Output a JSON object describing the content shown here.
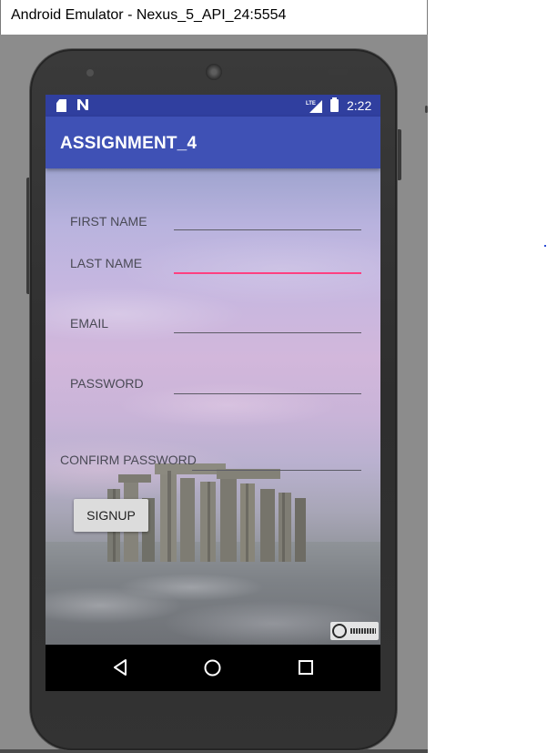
{
  "window": {
    "title": "Android Emulator - Nexus_5_API_24:5554"
  },
  "statusbar": {
    "time": "2:22",
    "network_label": "LTE",
    "icons": [
      "sd-card-icon",
      "n-notification-icon",
      "lte-signal-icon",
      "battery-icon"
    ]
  },
  "appbar": {
    "title": "ASSIGNMENT_4"
  },
  "form": {
    "first_name_label": "FIRST NAME",
    "first_name_value": "",
    "last_name_label": "LAST NAME",
    "last_name_value": "",
    "email_label": "EMAIL",
    "email_value": "",
    "password_label": "PASSWORD",
    "password_value": "",
    "confirm_password_label": "CONFIRM PASSWORD",
    "confirm_password_value": "",
    "signup_label": "SIGNUP",
    "focused_field": "last_name"
  },
  "navbar": {
    "icons": [
      "back-icon",
      "home-icon",
      "recents-icon"
    ]
  },
  "colors": {
    "status_bar": "#303f9f",
    "app_bar": "#3f51b5",
    "accent": "#ff4081",
    "button": "#dcdcdc"
  }
}
